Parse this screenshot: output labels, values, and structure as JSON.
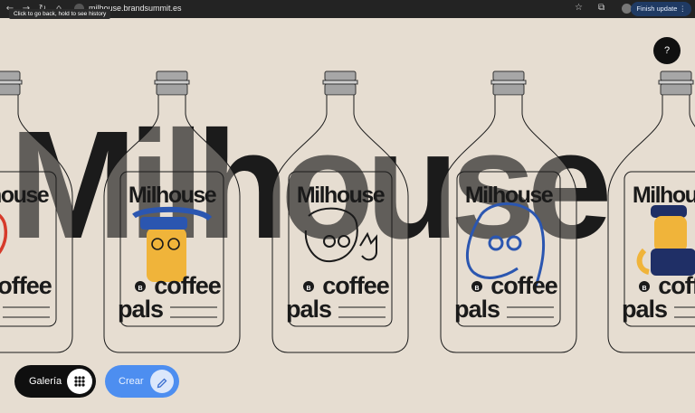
{
  "browser": {
    "url": "milhouse.brandsummit.es",
    "tooltip": "Click to go back, hold to see history",
    "finish_update_label": "Finish update",
    "icons": [
      "back-arrow-icon",
      "forward-arrow-icon",
      "reload-icon",
      "home-icon",
      "site-info-icon",
      "star-icon",
      "extensions-icon",
      "profile-avatar-icon",
      "more-menu-icon"
    ]
  },
  "hero": {
    "big_word": "Milhouse"
  },
  "label": {
    "brand": "Milhouse",
    "line1": "coffee",
    "line2": "pals",
    "badge": "B"
  },
  "help_label": "?",
  "buttons": {
    "gallery": "Galería",
    "create": "Crear"
  },
  "colors": {
    "background": "#e6ddd1",
    "cap": "#a3a3a3",
    "outline": "#1a1a1a",
    "yellow": "#f0b43a",
    "blue": "#2b56b0",
    "red": "#d63a2a",
    "create_button": "#4d8ef0"
  }
}
